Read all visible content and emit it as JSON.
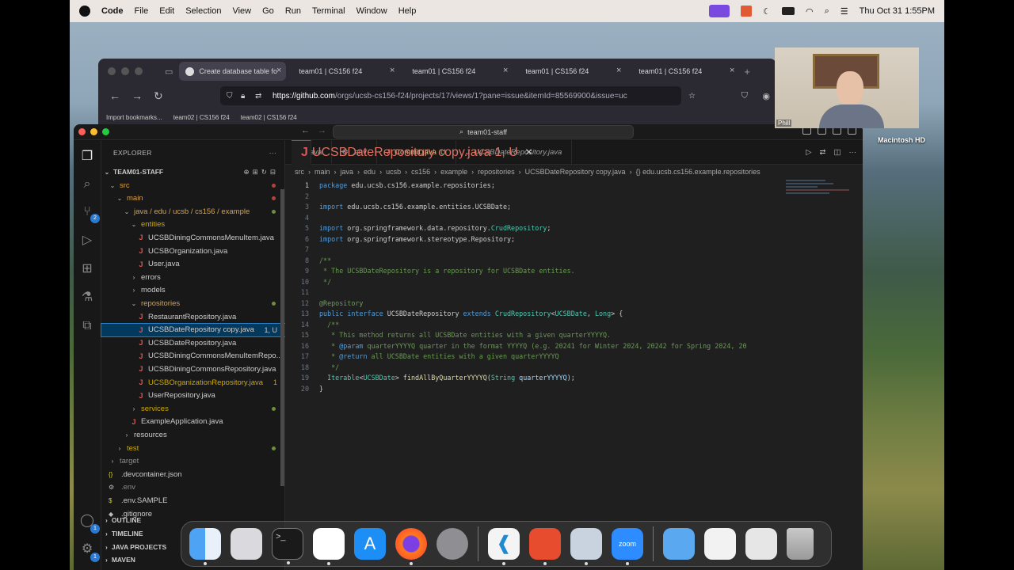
{
  "menubar": {
    "app": "Code",
    "items": [
      "File",
      "Edit",
      "Selection",
      "View",
      "Go",
      "Run",
      "Terminal",
      "Window",
      "Help"
    ],
    "clock": "Thu Oct 31  1:55PM"
  },
  "browser": {
    "tabs": [
      "Create database table fo",
      "team01 | CS156 f24",
      "team01 | CS156 f24",
      "team01 | CS156 f24",
      "team01 | CS156 f24"
    ],
    "url_host": "https://github.com",
    "url_path": "/orgs/ucsb-cs156-f24/projects/17/views/1?pane=issue&itemId=85569900&issue=uc",
    "bookmarks": [
      "Import bookmarks...",
      "team02 | CS156 f24",
      "team02 | CS156 f24"
    ]
  },
  "vscode": {
    "command_center": "team01-staff",
    "explorer_title": "EXPLORER",
    "workspace": "TEAM01-STAFF",
    "tree": [
      {
        "label": "src",
        "type": "folder",
        "depth": 1,
        "cls": "orange",
        "dot": "red"
      },
      {
        "label": "main",
        "type": "folder",
        "depth": 2,
        "cls": "orange",
        "dot": "red"
      },
      {
        "label": "java / edu / ucsb / cs156 / example",
        "type": "folder",
        "depth": 3,
        "cls": "orange",
        "dot": "green"
      },
      {
        "label": "entities",
        "type": "folder",
        "depth": 4,
        "cls": "yellow"
      },
      {
        "label": "UCSBDiningCommonsMenuItem.java",
        "type": "java",
        "depth": 5
      },
      {
        "label": "UCSBOrganization.java",
        "type": "java",
        "depth": 5
      },
      {
        "label": "User.java",
        "type": "java",
        "depth": 5
      },
      {
        "label": "errors",
        "type": "folder-c",
        "depth": 4
      },
      {
        "label": "models",
        "type": "folder-c",
        "depth": 4
      },
      {
        "label": "repositories",
        "type": "folder",
        "depth": 4,
        "cls": "orange",
        "dot": "green"
      },
      {
        "label": "RestaurantRepository.java",
        "type": "java",
        "depth": 5
      },
      {
        "label": "UCSBDateRepository copy.java",
        "type": "java",
        "depth": 5,
        "status": "1, U",
        "selected": true
      },
      {
        "label": "UCSBDateRepository.java",
        "type": "java",
        "depth": 5
      },
      {
        "label": "UCSBDiningCommonsMenuItemRepo...",
        "type": "java",
        "depth": 5
      },
      {
        "label": "UCSBDiningCommonsRepository.java",
        "type": "java",
        "depth": 5
      },
      {
        "label": "UCSBOrganizationRepository.java",
        "type": "java",
        "depth": 5,
        "cls": "yellow",
        "status": "1"
      },
      {
        "label": "UserRepository.java",
        "type": "java",
        "depth": 5
      },
      {
        "label": "services",
        "type": "folder-c",
        "depth": 4,
        "cls": "yellow",
        "dot": "green"
      },
      {
        "label": "ExampleApplication.java",
        "type": "java",
        "depth": 4
      },
      {
        "label": "resources",
        "type": "folder-c",
        "depth": 3
      },
      {
        "label": "test",
        "type": "folder-c",
        "depth": 2,
        "cls": "yellow",
        "dot": "green"
      },
      {
        "label": "target",
        "type": "folder-c",
        "depth": 1,
        "cls": "grey"
      },
      {
        "label": ".devcontainer.json",
        "type": "json",
        "depth": 1
      },
      {
        "label": ".env",
        "type": "gear",
        "depth": 1,
        "cls": "grey"
      },
      {
        "label": ".env.SAMPLE",
        "type": "dollar",
        "depth": 1
      },
      {
        "label": ".gitignore",
        "type": "git",
        "depth": 1
      }
    ],
    "panels": [
      "OUTLINE",
      "TIMELINE",
      "JAVA PROJECTS",
      "MAVEN"
    ],
    "editor_tabs": [
      {
        "label": "iller.java",
        "icon": "",
        "status": ""
      },
      {
        "label": ".env",
        "icon": "gear",
        "status": ""
      },
      {
        "label": "Commit.java",
        "icon": "J",
        "status": "U"
      },
      {
        "label": "UCSBDateRepository.java",
        "icon": "J",
        "status": "",
        "italic": true
      },
      {
        "label": "UCSBDateRepository copy.java",
        "icon": "J",
        "status": "1, U",
        "active": true
      }
    ],
    "breadcrumb": [
      "src",
      "main",
      "java",
      "edu",
      "ucsb",
      "cs156",
      "example",
      "repositories",
      "UCSBDateRepository copy.java",
      "{} edu.ucsb.cs156.example.repositories"
    ],
    "code": [
      "package edu.ucsb.cs156.example.repositories;",
      "",
      "import edu.ucsb.cs156.example.entities.UCSBDate;",
      "",
      "import org.springframework.data.repository.CrudRepository;",
      "import org.springframework.stereotype.Repository;",
      "",
      "/**",
      " * The UCSBDateRepository is a repository for UCSBDate entities.",
      " */",
      "",
      "@Repository",
      "public interface UCSBDateRepository extends CrudRepository<UCSBDate, Long> {",
      "  /**",
      "   * This method returns all UCSBDate entities with a given quarterYYYYQ.",
      "   * @param quarterYYYYQ quarter in the format YYYYQ (e.g. 20241 for Winter 2024, 20242 for Spring 2024, 20",
      "   * @return all UCSBDate entities with a given quarterYYYYQ",
      "   */",
      "  Iterable<UCSBDate> findAllByQuarterYYYYQ(String quarterYYYYQ);",
      "}"
    ]
  },
  "webcam": {
    "name": "Phill"
  },
  "desktop": {
    "drive": "Macintosh HD"
  },
  "dock": [
    "Finder",
    "Launchpad",
    "Terminal",
    "Slack",
    "App Store",
    "Firefox",
    "System Settings",
    "Visual Studio Code",
    "Tools",
    "Preview",
    "Zoom",
    "Folder",
    "Document",
    "Document",
    "Trash"
  ]
}
